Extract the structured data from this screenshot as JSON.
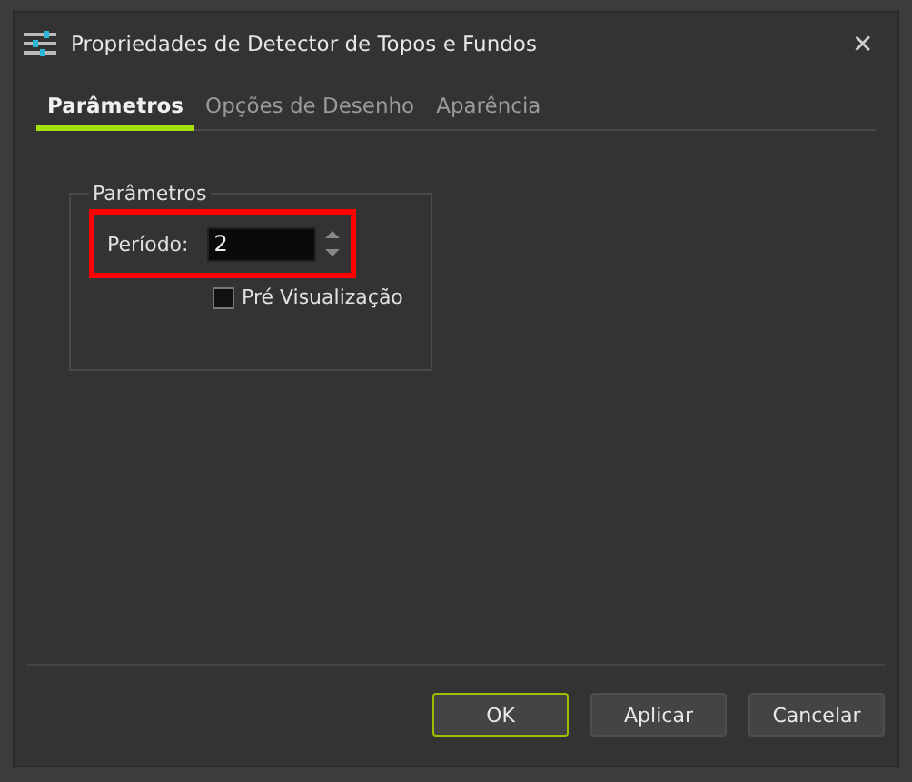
{
  "window": {
    "title": "Propriedades de Detector de Topos e Fundos",
    "close": "✕"
  },
  "tabs": [
    {
      "label": "Parâmetros",
      "selected": true
    },
    {
      "label": "Opções de Desenho",
      "selected": false
    },
    {
      "label": "Aparência",
      "selected": false
    }
  ],
  "group": {
    "title": "Parâmetros",
    "period": {
      "label": "Período:",
      "value": "2",
      "highlighted": true
    },
    "preview": {
      "label": "Pré Visualização",
      "checked": false
    }
  },
  "buttons": [
    {
      "label": "OK",
      "default": true
    },
    {
      "label": "Aplicar",
      "default": false
    },
    {
      "label": "Cancelar",
      "default": false
    }
  ]
}
